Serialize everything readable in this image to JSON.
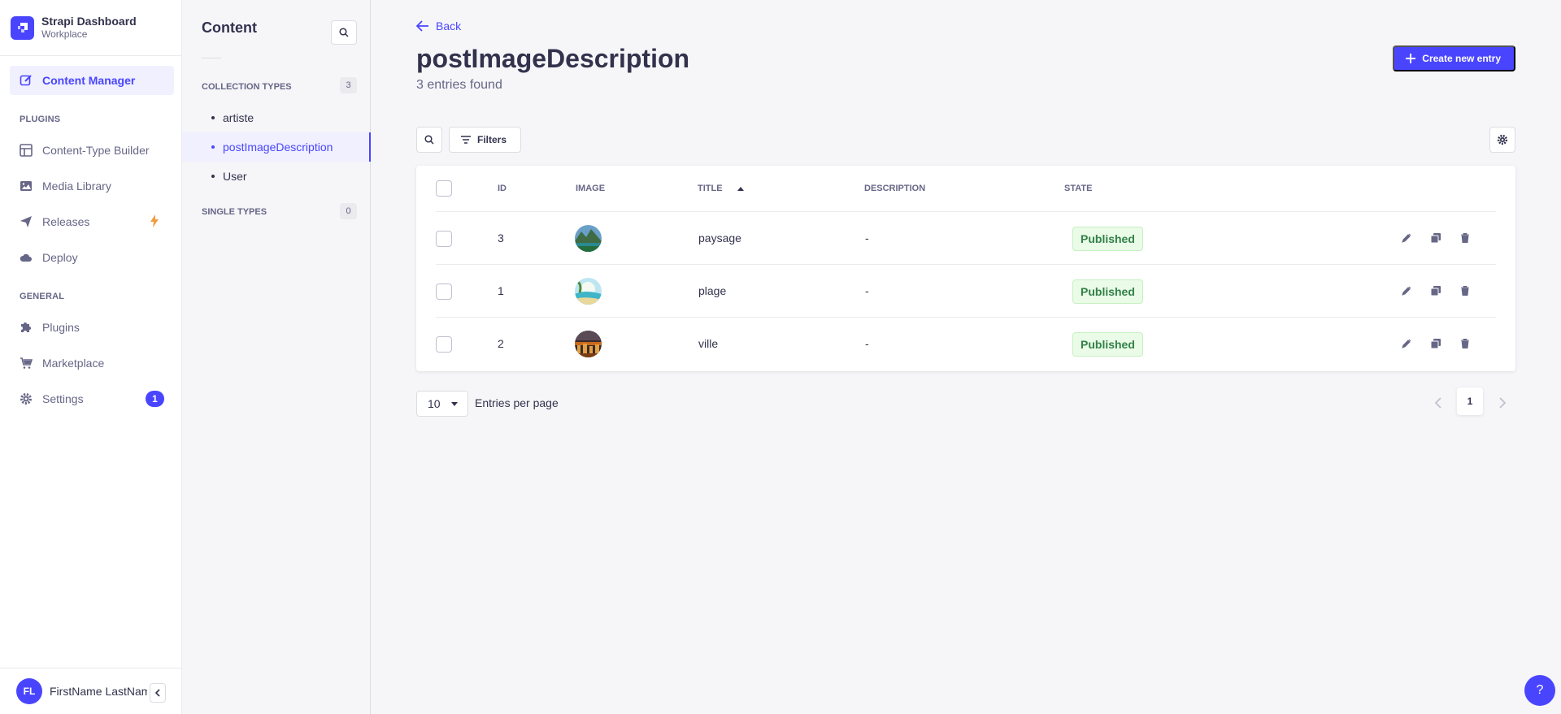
{
  "brand": {
    "title": "Strapi Dashboard",
    "subtitle": "Workplace"
  },
  "mainnav": {
    "items": [
      {
        "label": "Content Manager",
        "icon": "feather-pen-icon",
        "active": true
      },
      {
        "label": "Content-Type Builder",
        "icon": "layout-icon"
      },
      {
        "label": "Media Library",
        "icon": "image-icon"
      },
      {
        "label": "Releases",
        "icon": "paper-plane-icon",
        "marker": "lightning-icon"
      },
      {
        "label": "Deploy",
        "icon": "cloud-icon"
      },
      {
        "label": "Plugins",
        "icon": "puzzle-icon"
      },
      {
        "label": "Marketplace",
        "icon": "shopping-cart-icon"
      },
      {
        "label": "Settings",
        "icon": "gear-icon",
        "badge": "1"
      }
    ],
    "sections": {
      "plugins": "PLUGINS",
      "general": "GENERAL"
    }
  },
  "user": {
    "initials": "FL",
    "name": "FirstName LastName"
  },
  "subnav": {
    "title": "Content",
    "collection_types": {
      "label": "COLLECTION TYPES",
      "count": "3",
      "items": [
        "artiste",
        "postImageDescription",
        "User"
      ]
    },
    "single_types": {
      "label": "SINGLE TYPES",
      "count": "0"
    }
  },
  "header": {
    "back": "Back",
    "title": "postImageDescription",
    "subtitle": "3 entries found",
    "create_button": "Create new entry"
  },
  "toolbar": {
    "filters": "Filters"
  },
  "table": {
    "columns": {
      "id": "ID",
      "image": "IMAGE",
      "title": "TITLE",
      "description": "DESCRIPTION",
      "state": "STATE"
    },
    "rows": [
      {
        "id": "3",
        "title": "paysage",
        "description": "-",
        "state": "Published",
        "thumb": "mountain-lake"
      },
      {
        "id": "1",
        "title": "plage",
        "description": "-",
        "state": "Published",
        "thumb": "beach"
      },
      {
        "id": "2",
        "title": "ville",
        "description": "-",
        "state": "Published",
        "thumb": "city-night"
      }
    ]
  },
  "pagination": {
    "per_page": "10",
    "per_page_label": "Entries per page",
    "current_page": "1"
  },
  "colors": {
    "primary": "#4945ff",
    "success_text": "#328048",
    "success_bg": "#eafbe7",
    "warning": "#f29d41"
  },
  "help": "?"
}
